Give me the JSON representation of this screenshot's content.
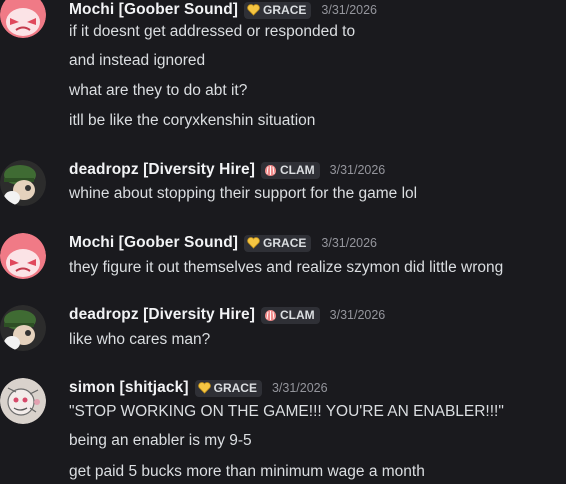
{
  "messages": [
    {
      "author": "Mochi [Goober Sound]",
      "tag": "GRACE",
      "tag_icon": "yellow-heart-icon",
      "timestamp": "3/31/2026",
      "avatar": "pink-angry-face-avatar",
      "lines": [
        "if it doesnt get addressed or responded to",
        "and instead ignored",
        "what are they to do abt it?",
        "itll be like the coryxkenshin situation"
      ]
    },
    {
      "author": "deadropz [Diversity Hire]",
      "tag": "CLAM",
      "tag_icon": "clam-icon",
      "timestamp": "3/31/2026",
      "avatar": "green-character-avatar",
      "lines": [
        "whine about stopping their support for the game lol"
      ]
    },
    {
      "author": "Mochi [Goober Sound]",
      "tag": "GRACE",
      "tag_icon": "yellow-heart-icon",
      "timestamp": "3/31/2026",
      "avatar": "pink-angry-face-avatar",
      "lines": [
        "they figure it out themselves and realize szymon did little wrong"
      ]
    },
    {
      "author": "deadropz [Diversity Hire]",
      "tag": "CLAM",
      "tag_icon": "clam-icon",
      "timestamp": "3/31/2026",
      "avatar": "green-character-avatar",
      "lines": [
        "like who cares man?"
      ]
    },
    {
      "author": "simon [shitjack]",
      "tag": "GRACE",
      "tag_icon": "yellow-heart-icon",
      "timestamp": "3/31/2026",
      "avatar": "sketch-character-avatar",
      "lines": [
        "\"STOP WORKING ON THE GAME!!! YOU'RE AN ENABLER!!!\"",
        "being an enabler is my 9-5",
        "get paid 5 bucks more than minimum wage a month"
      ]
    }
  ]
}
